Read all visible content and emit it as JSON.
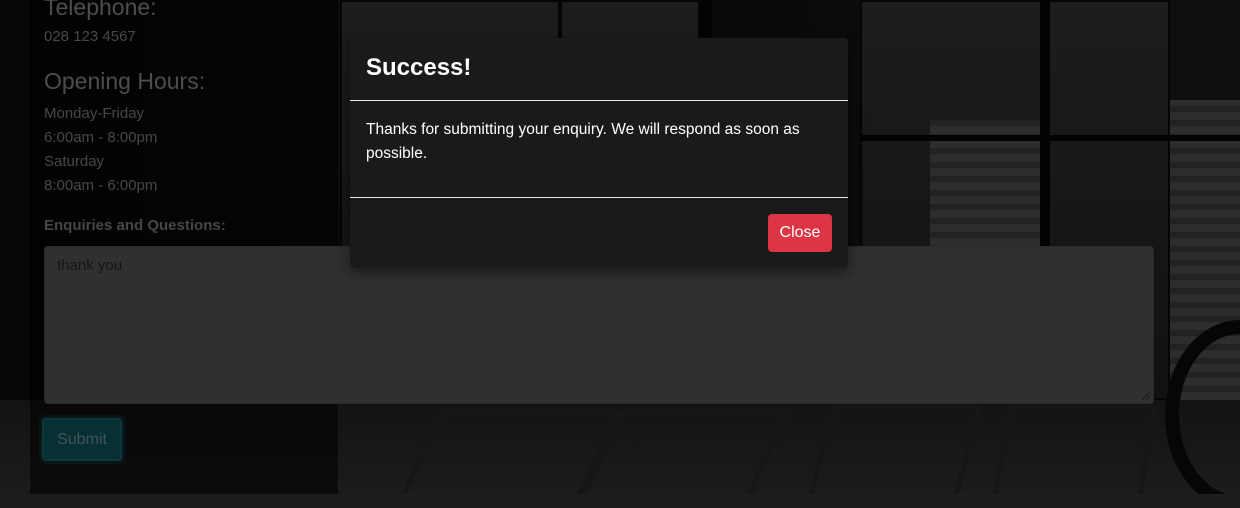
{
  "contact": {
    "telephone_heading": "Telephone:",
    "telephone_number": "028 123 4567",
    "hours_heading": "Opening Hours:",
    "hours_lines": [
      "Monday-Friday",
      "6:00am - 8:00pm",
      "Saturday",
      "8:00am - 6:00pm"
    ]
  },
  "enquiry_form": {
    "label": "Enquiries and Questions:",
    "textarea_value": "thank you",
    "submit_label": "Submit"
  },
  "modal": {
    "title": "Success!",
    "message": "Thanks for submitting your enquiry. We will respond as soon as possible.",
    "close_label": "Close"
  },
  "colors": {
    "close_button": "#dc3545",
    "submit_button": "#0f5e68",
    "modal_background": "#1a1a1a"
  }
}
